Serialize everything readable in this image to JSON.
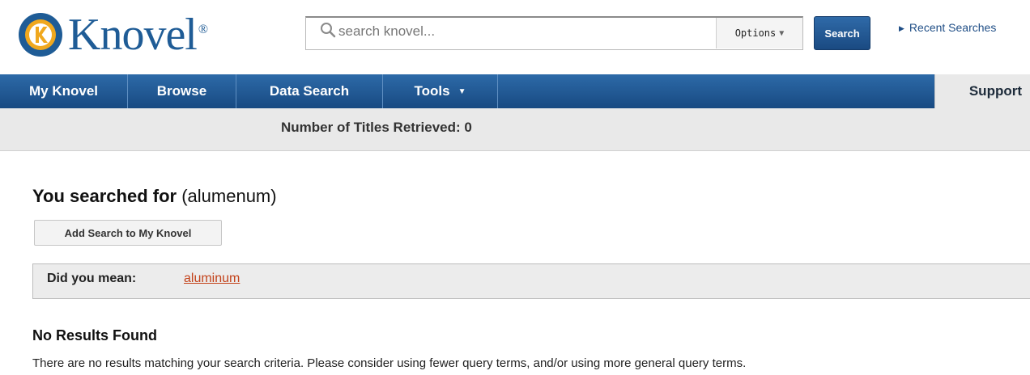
{
  "header": {
    "logo_text": "Knovel",
    "logo_mark": "®",
    "search_placeholder": "search knovel...",
    "options_label": "Options",
    "search_button": "Search",
    "recent_searches": "Recent Searches"
  },
  "nav": {
    "items": [
      {
        "label": "My Knovel"
      },
      {
        "label": "Browse"
      },
      {
        "label": "Data Search"
      },
      {
        "label": "Tools"
      }
    ],
    "support": "Support"
  },
  "results": {
    "count_text": "Number of Titles Retrieved: 0",
    "searched_label": "You searched for",
    "searched_query": "(alumenum)",
    "add_button": "Add Search to My Knovel",
    "did_you_mean_label": "Did you mean:",
    "suggestion": "aluminum",
    "no_results_title": "No Results Found",
    "no_results_message": "There are no results matching your search criteria. Please consider using fewer query terms, and/or using more general query terms."
  },
  "colors": {
    "brand_blue": "#1f5c96",
    "nav_blue": "#245c99",
    "link_orange": "#c3431b"
  }
}
